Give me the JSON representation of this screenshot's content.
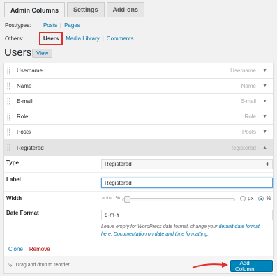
{
  "tabs": [
    {
      "label": "Admin Columns",
      "active": true
    },
    {
      "label": "Settings",
      "active": false
    },
    {
      "label": "Add-ons",
      "active": false
    }
  ],
  "posttypes": {
    "label": "Posttypes:",
    "items": [
      "Posts",
      "Pages"
    ]
  },
  "others": {
    "label": "Others:",
    "current": "Users",
    "items": [
      "Media Library",
      "Comments"
    ]
  },
  "heading": {
    "title": "Users",
    "view": "View"
  },
  "columns": [
    {
      "name": "Username",
      "label": "Username"
    },
    {
      "name": "Name",
      "label": "Name"
    },
    {
      "name": "E-mail",
      "label": "E-mail"
    },
    {
      "name": "Role",
      "label": "Role"
    },
    {
      "name": "Posts",
      "label": "Posts"
    },
    {
      "name": "Registered",
      "label": "Registered"
    }
  ],
  "settings": {
    "type": {
      "label": "Type",
      "value": "Registered"
    },
    "label": {
      "label": "Label",
      "value": "Registered"
    },
    "width": {
      "label": "Width",
      "auto": "auto",
      "percent_sign": "%",
      "px": "px",
      "pct": "%",
      "unit": "%"
    },
    "date_format": {
      "label": "Date Format",
      "value": "d-m-Y",
      "help_prefix": "Leave empty for WordPress date format, change your ",
      "help_link1": "default date format here",
      "help_middle": ". ",
      "help_link2": "Documentation on date and time formatting",
      "help_suffix": "."
    }
  },
  "actions": {
    "clone": "Clone",
    "remove": "Remove"
  },
  "footer": {
    "reorder": "Drag and drop to reorder",
    "add_column": "+ Add Column"
  },
  "colors": {
    "accent": "#0073aa",
    "button": "#0085ba",
    "highlight": "#e0302b",
    "remove": "#aa0000"
  },
  "icons": {
    "reorder": "curved-arrow-icon",
    "select": "select-arrows-icon",
    "row_toggle": "triangle-down-icon",
    "grip": "drag-grip-icon"
  }
}
